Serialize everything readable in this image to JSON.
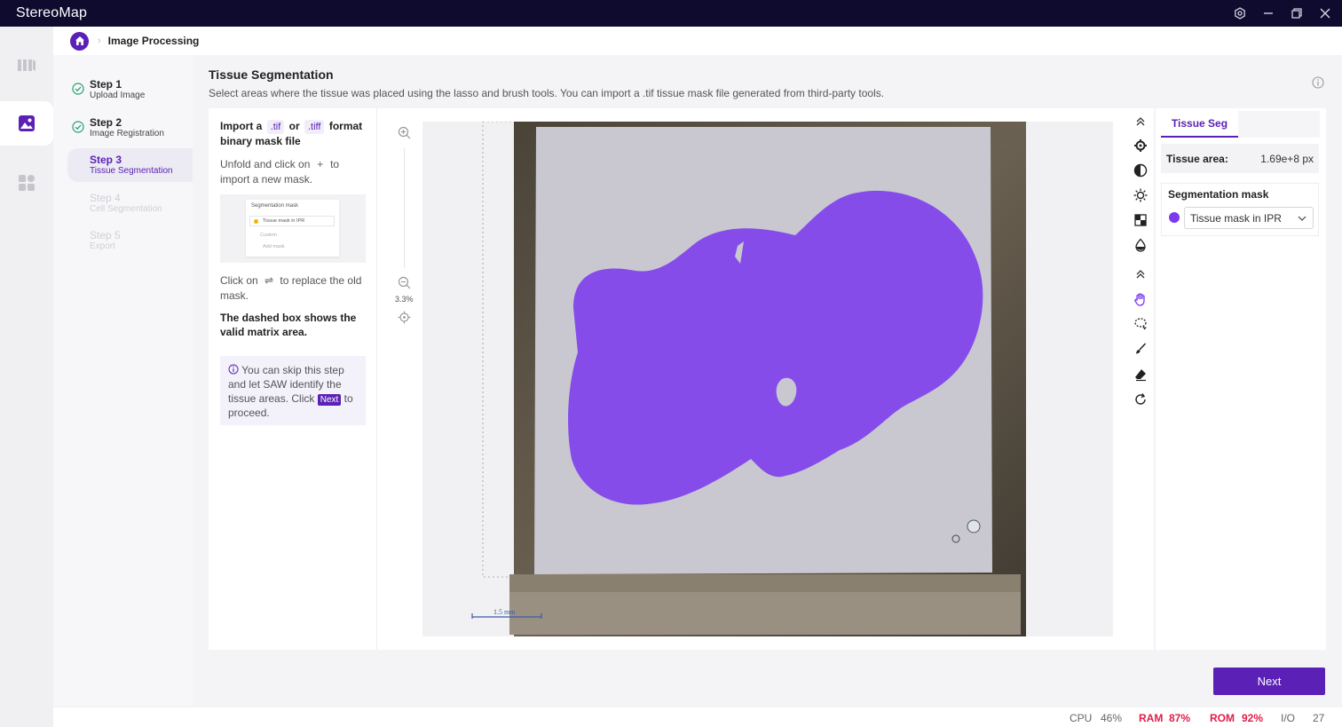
{
  "app": {
    "title": "StereoMap"
  },
  "breadcrumb": {
    "title": "Image Processing"
  },
  "steps": [
    {
      "title": "Step 1",
      "subtitle": "Upload Image"
    },
    {
      "title": "Step 2",
      "subtitle": "Image Registration"
    },
    {
      "title": "Step 3",
      "subtitle": "Tissue Segmentation"
    },
    {
      "title": "Step 4",
      "subtitle": "Cell Segmentation"
    },
    {
      "title": "Step 5",
      "subtitle": "Export"
    }
  ],
  "main": {
    "title": "Tissue Segmentation",
    "description": "Select areas where the tissue was placed using the lasso and brush tools. You can import a .tif tissue mask file generated from third-party tools."
  },
  "guide": {
    "import_prefix": "Import a",
    "tif": ".tif",
    "or": "or",
    "tiff": ".tiff",
    "format": "format",
    "binary": "binary mask file",
    "unfold_text": "Unfold and click on",
    "unfold_plus": "+",
    "unfold_to": "to",
    "unfold_rest": "import a new mask.",
    "thumb_title": "Segmentation mask",
    "thumb_item": "Tissue mask in IPR",
    "thumb_custom": "Custom",
    "thumb_add": "Add mask",
    "replace_text": "Click on",
    "replace_icon": "⇌",
    "replace_rest": "to replace the old mask.",
    "dashed_text": "The dashed box shows the valid matrix area.",
    "note_part1": "You can skip this step and let SAW identify the tissue areas. Click",
    "note_next": "Next",
    "note_part2": "to proceed."
  },
  "zoom": {
    "level": "3.3%"
  },
  "canvas": {
    "scale_label": "1.5 mm"
  },
  "right_panel": {
    "tab": "Tissue Seg",
    "tissue_area_label": "Tissue area:",
    "tissue_area_value": "1.69e+8 px",
    "seg_mask_label": "Segmentation mask",
    "seg_mask_selected": "Tissue mask in IPR",
    "mask_color": "#7c3aed"
  },
  "actions": {
    "next": "Next"
  },
  "status": {
    "cpu_label": "CPU",
    "cpu_value": "46%",
    "ram_label": "RAM",
    "ram_value": "87%",
    "rom_label": "ROM",
    "rom_value": "92%",
    "io_label": "I/O",
    "io_value": "27"
  },
  "colors": {
    "accent": "#5b21b6",
    "titlebar": "#0e0b2e",
    "warning": "#e11d48"
  }
}
